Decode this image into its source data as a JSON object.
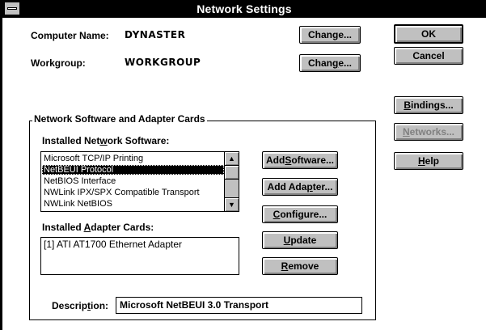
{
  "window": {
    "title": "Network Settings"
  },
  "computer_name": {
    "label": "Computer Name:",
    "value": "DYNASTER",
    "change_button": {
      "pre": "Change...",
      "ul": "",
      "post": ""
    }
  },
  "workgroup": {
    "label": "Workgroup:",
    "value": "WORKGROUP",
    "change_button": {
      "pre": "Chan",
      "ul": "g",
      "post": "e..."
    }
  },
  "side_buttons": {
    "ok": "OK",
    "cancel": "Cancel",
    "bindings": {
      "ul": "B",
      "post": "indings..."
    },
    "networks": {
      "ul": "N",
      "post": "etworks..."
    },
    "help": {
      "ul": "H",
      "post": "elp"
    }
  },
  "group": {
    "title": "Network Software and Adapter Cards",
    "installed_software_label": {
      "pre": "Installed Net",
      "ul": "w",
      "post": "ork Software:"
    },
    "software_items": [
      {
        "label": "Microsoft TCP/IP Printing",
        "selected": false
      },
      {
        "label": "NetBEUI Protocol",
        "selected": true
      },
      {
        "label": "NetBIOS Interface",
        "selected": false
      },
      {
        "label": "NWLink IPX/SPX Compatible Transport",
        "selected": false
      },
      {
        "label": "NWLink NetBIOS",
        "selected": false
      }
    ],
    "installed_adapters_label": {
      "pre": "Installed ",
      "ul": "A",
      "post": "dapter Cards:"
    },
    "adapter_items": [
      {
        "label": "[1] ATI AT1700 Ethernet Adapter"
      }
    ],
    "add_software": {
      "pre": "Add ",
      "ul": "S",
      "post": "oftware..."
    },
    "add_adapter": {
      "pre": "Add Ada",
      "ul": "p",
      "post": "ter..."
    },
    "configure": {
      "pre": "",
      "ul": "C",
      "post": "onfigure..."
    },
    "update": {
      "pre": "",
      "ul": "U",
      "post": "pdate"
    },
    "remove": {
      "pre": "",
      "ul": "R",
      "post": "emove"
    },
    "description_label": {
      "pre": "Descrip",
      "ul": "t",
      "post": "ion:"
    },
    "description_value": "Microsoft NetBEUI 3.0 Transport"
  },
  "icons": {
    "system_menu": "system-menu-icon",
    "scroll_up": "▲",
    "scroll_down": "▼"
  }
}
